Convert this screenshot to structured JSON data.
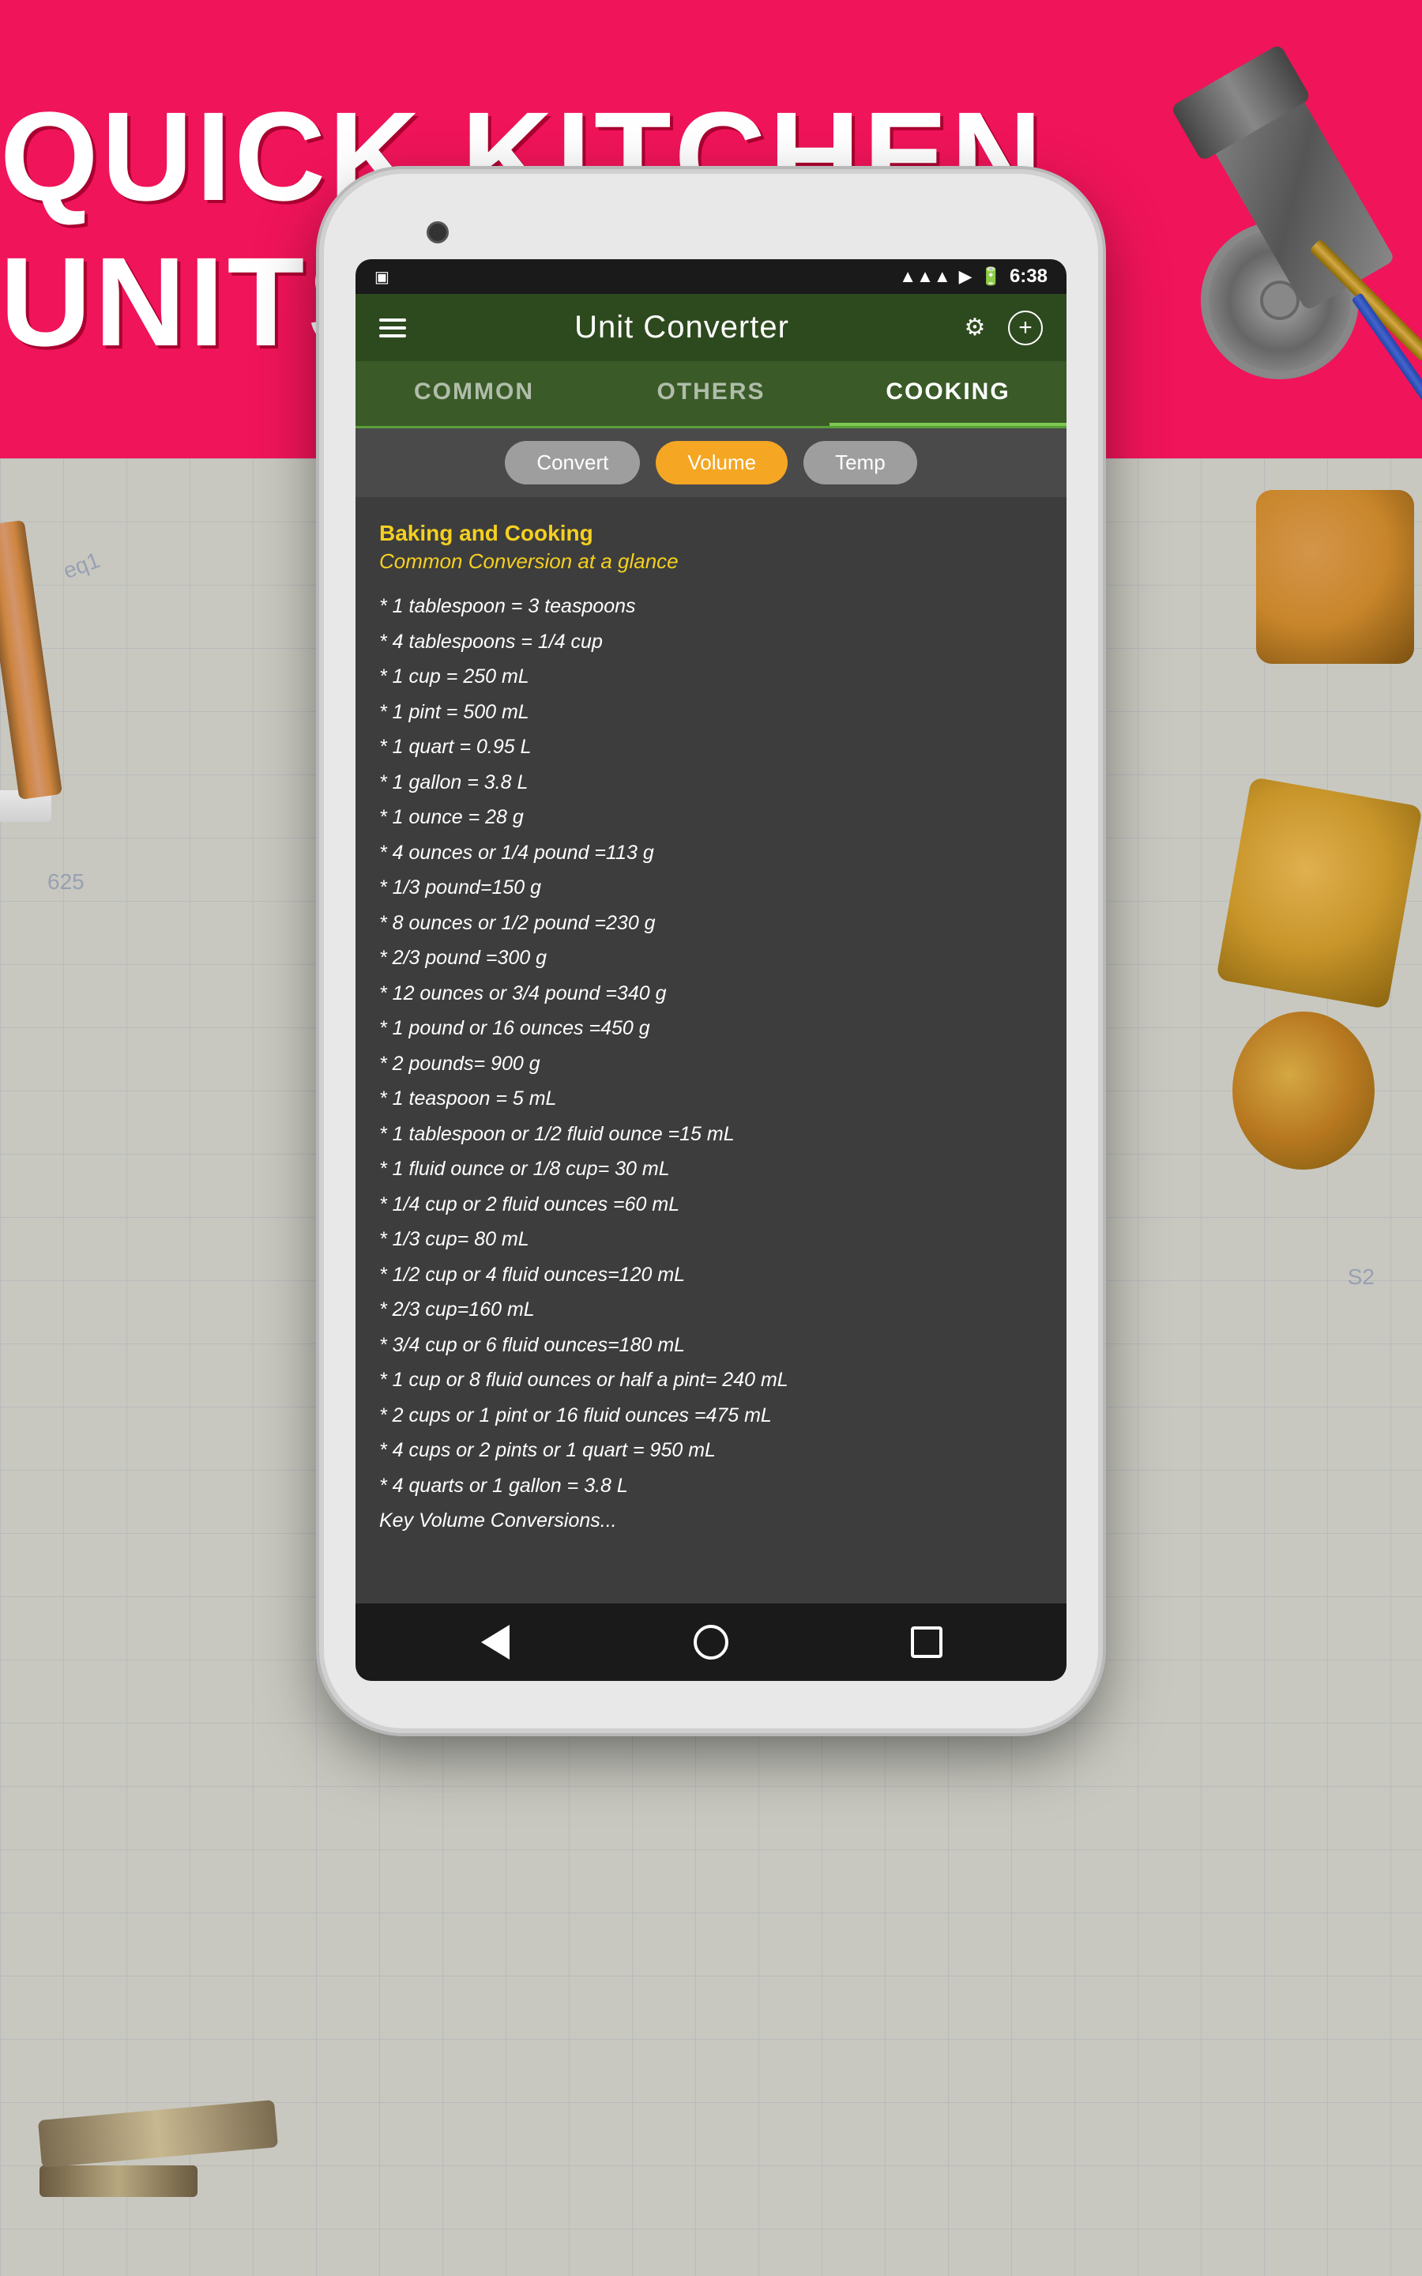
{
  "banner": {
    "title": "QUICK KITCHEN UNITS"
  },
  "phone": {
    "status_bar": {
      "time": "6:38",
      "battery_icon": "🔋",
      "wifi_icon": "📶",
      "signal_icon": "📡"
    },
    "toolbar": {
      "title": "Unit Converter",
      "settings_icon": "⚙",
      "add_icon": "+"
    },
    "tabs": [
      {
        "label": "COMMON",
        "active": false
      },
      {
        "label": "OTHERS",
        "active": false
      },
      {
        "label": "COOKING",
        "active": true
      }
    ],
    "subtabs": [
      {
        "label": "Convert",
        "style": "default"
      },
      {
        "label": "Volume",
        "style": "active-orange"
      },
      {
        "label": "Temp",
        "style": "default"
      }
    ],
    "content": {
      "section_title": "Baking and Cooking",
      "section_subtitle": "Common Conversion at a glance",
      "conversions": [
        "* 1 tablespoon = 3 teaspoons",
        "* 4 tablespoons = 1/4 cup",
        "* 1 cup = 250 mL",
        "* 1 pint = 500 mL",
        "* 1 quart = 0.95 L",
        "* 1 gallon = 3.8 L",
        "* 1 ounce = 28 g",
        "* 4 ounces or 1/4 pound =113 g",
        "* 1/3 pound=150 g",
        "* 8 ounces or 1/2 pound =230 g",
        "* 2/3 pound =300 g",
        "* 12 ounces or 3/4 pound =340 g",
        "* 1 pound or 16 ounces =450 g",
        "* 2 pounds= 900 g",
        "* 1 teaspoon = 5 mL",
        "* 1 tablespoon or 1/2 fluid ounce =15 mL",
        "* 1 fluid ounce or 1/8 cup= 30 mL",
        "* 1/4 cup or 2 fluid ounces =60 mL",
        "* 1/3 cup= 80 mL",
        "* 1/2 cup or 4 fluid ounces=120 mL",
        "* 2/3 cup=160 mL",
        "* 3/4 cup or 6 fluid ounces=180 mL",
        "* 1 cup or 8 fluid ounces or half a pint= 240 mL",
        "* 2 cups or 1 pint or 16 fluid ounces =475 mL",
        "* 4 cups or 2 pints or 1 quart = 950 mL",
        "* 4 quarts or 1 gallon = 3.8 L",
        "Key Volume Conversions..."
      ]
    },
    "nav_buttons": {
      "back": "◀",
      "home": "●",
      "recent": "■"
    }
  }
}
